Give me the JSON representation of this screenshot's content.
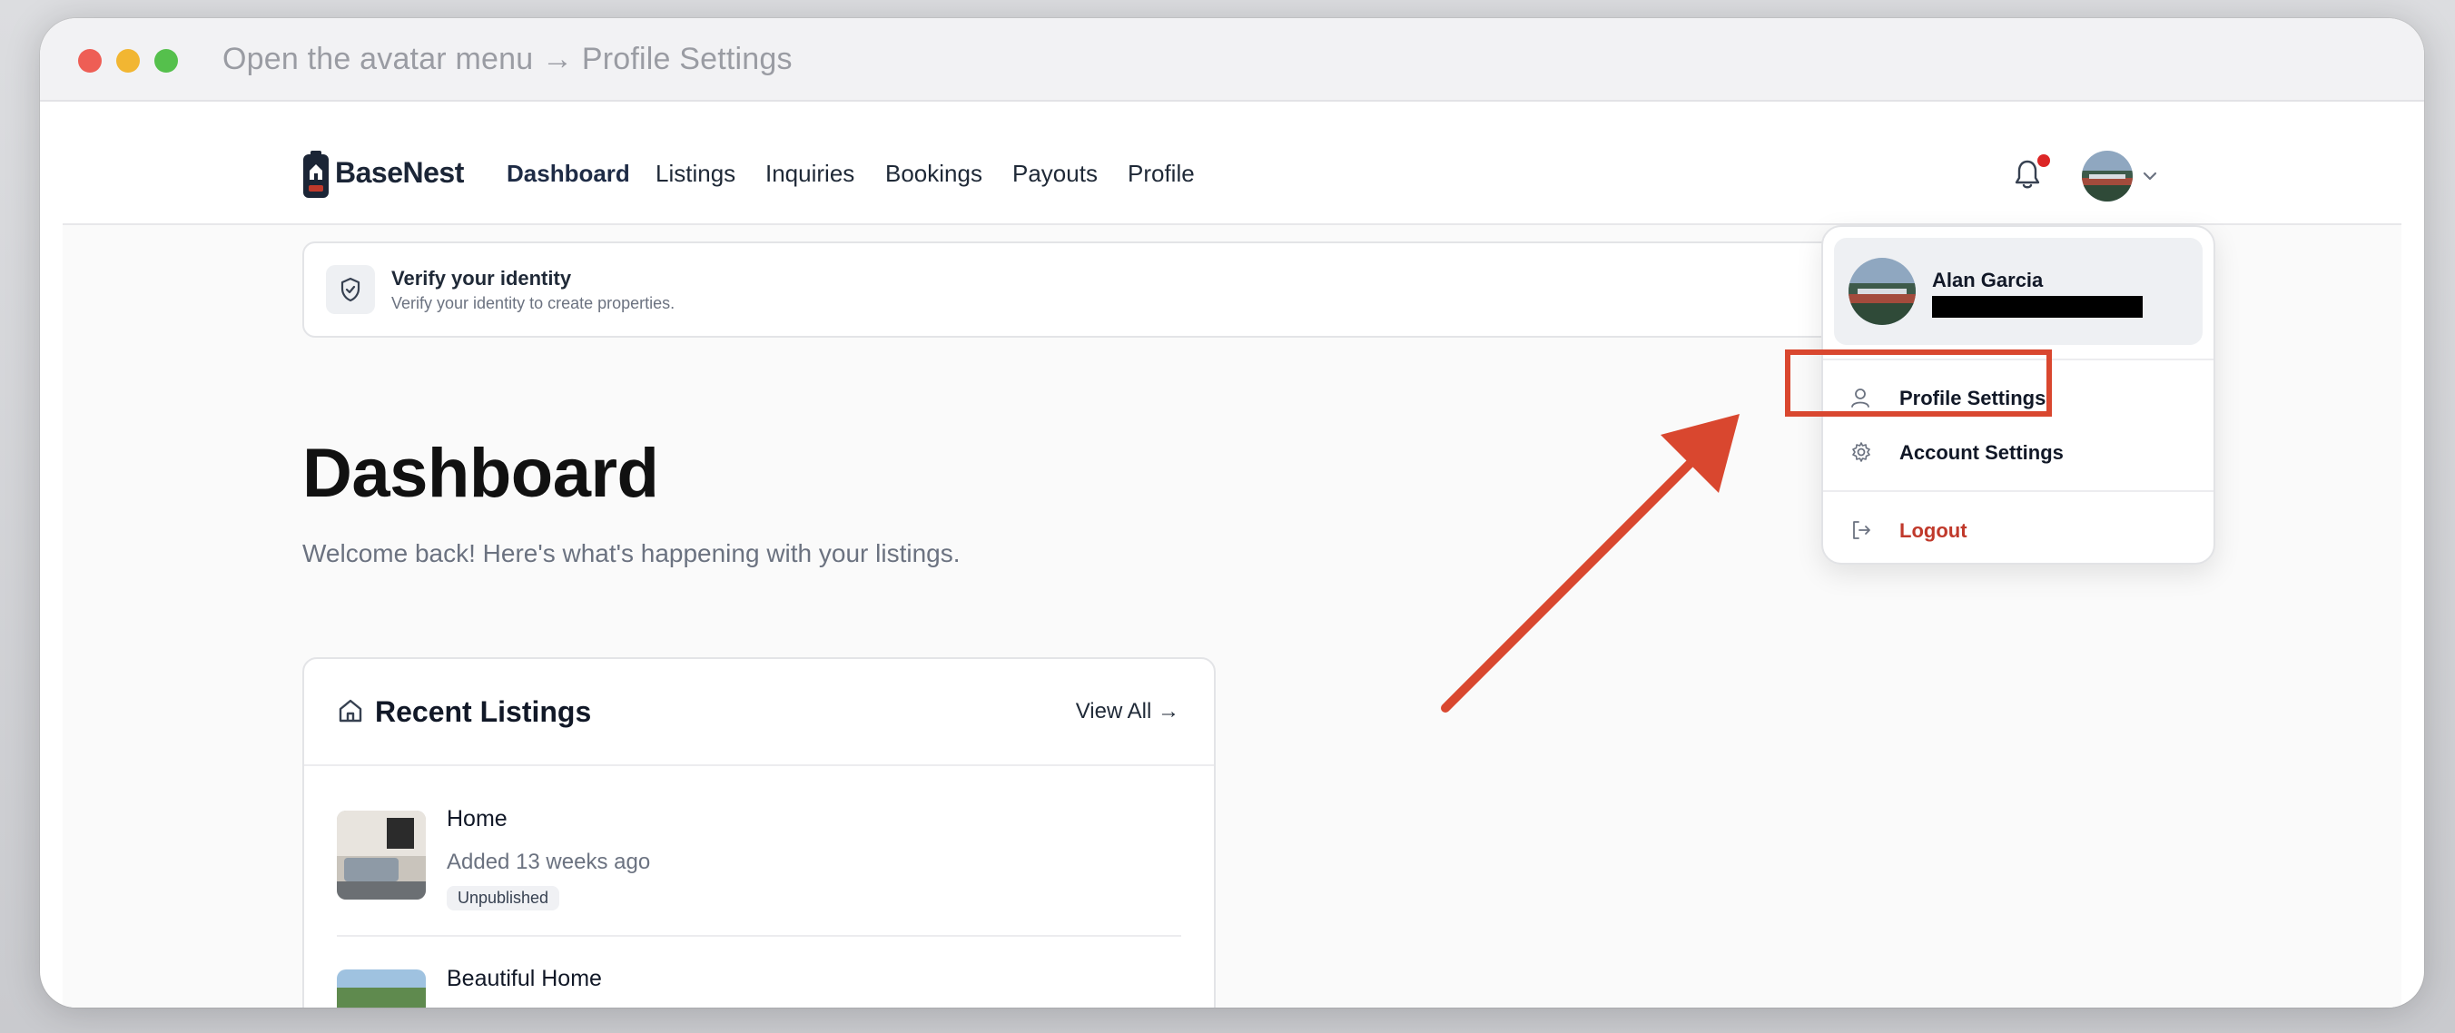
{
  "window": {
    "title": "Open the avatar menu → Profile Settings"
  },
  "nav": {
    "brand": "BaseNest",
    "links": [
      "Dashboard",
      "Listings",
      "Inquiries",
      "Bookings",
      "Payouts",
      "Profile"
    ],
    "active": "Dashboard"
  },
  "verify": {
    "title": "Verify your identity",
    "subtitle": "Verify your identity to create properties."
  },
  "page": {
    "title": "Dashboard",
    "subtitle": "Welcome back! Here's what's happening with your listings."
  },
  "recent_listings": {
    "title": "Recent Listings",
    "view_all": "View All →",
    "items": [
      {
        "name": "Home",
        "added": "Added 13 weeks ago",
        "status": "Unpublished"
      },
      {
        "name": "Beautiful Home"
      }
    ]
  },
  "user_menu": {
    "name": "Alan Garcia",
    "email": "[redacted]",
    "items": [
      "Profile Settings",
      "Account Settings",
      "Logout"
    ]
  },
  "colors": {
    "highlight": "#d9472f",
    "logout": "#c0392b",
    "notification": "#dc2626"
  },
  "icons": [
    "bell-icon",
    "chevron-down-icon",
    "shield-check-icon",
    "home-icon",
    "user-icon",
    "gear-icon",
    "logout-icon",
    "arrow-right-icon"
  ]
}
